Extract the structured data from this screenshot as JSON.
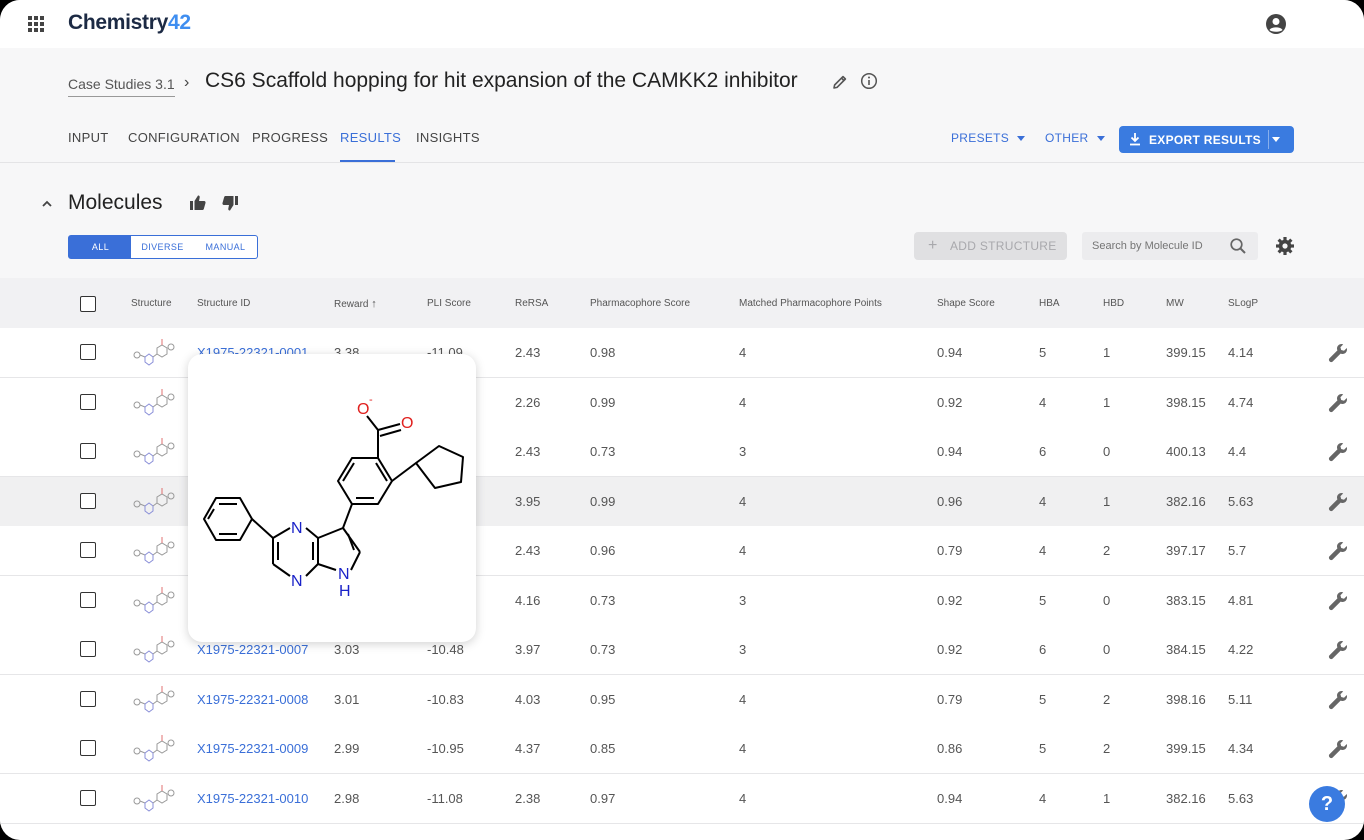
{
  "app": {
    "logo_main": "Chemistry",
    "logo_num": "42"
  },
  "breadcrumb": {
    "parent": "Case Studies 3.1",
    "separator": "›"
  },
  "page_title": "CS6 Scaffold hopping for hit expansion of the CAMKK2 inhibitor",
  "tabs": [
    "INPUT",
    "CONFIGURATION",
    "PROGRESS",
    "RESULTS",
    "INSIGHTS"
  ],
  "active_tab": "RESULTS",
  "header_buttons": {
    "presets": "PRESETS",
    "other": "OTHER",
    "export": "EXPORT RESULTS"
  },
  "section": {
    "title": "Molecules",
    "filters": [
      "ALL",
      "DIVERSE",
      "MANUAL"
    ],
    "active_filter": "ALL",
    "add_structure": "ADD STRUCTURE",
    "search_placeholder": "Search by Molecule ID"
  },
  "table": {
    "columns": [
      "Structure",
      "Structure ID",
      "Reward",
      "PLI Score",
      "ReRSA",
      "Pharmacophore Score",
      "Matched Pharmacophore Points",
      "Shape Score",
      "HBA",
      "HBD",
      "MW",
      "SLogP"
    ],
    "sort_indicator": "↑",
    "rows": [
      {
        "id": "X1975-22321-0001",
        "reward": "3.38",
        "pli": "-11.09",
        "rersa": "2.43",
        "pharm": "0.98",
        "matched": "4",
        "shape": "0.94",
        "hba": "5",
        "hbd": "1",
        "mw": "399.15",
        "slogp": "4.14"
      },
      {
        "id": "",
        "reward": "",
        "pli": "",
        "rersa": "2.26",
        "pharm": "0.99",
        "matched": "4",
        "shape": "0.92",
        "hba": "4",
        "hbd": "1",
        "mw": "398.15",
        "slogp": "4.74"
      },
      {
        "id": "",
        "reward": "",
        "pli": "",
        "rersa": "2.43",
        "pharm": "0.73",
        "matched": "3",
        "shape": "0.94",
        "hba": "6",
        "hbd": "0",
        "mw": "400.13",
        "slogp": "4.4"
      },
      {
        "id": "",
        "reward": "",
        "pli": "",
        "rersa": "3.95",
        "pharm": "0.99",
        "matched": "4",
        "shape": "0.96",
        "hba": "4",
        "hbd": "1",
        "mw": "382.16",
        "slogp": "5.63"
      },
      {
        "id": "",
        "reward": "",
        "pli": "",
        "rersa": "2.43",
        "pharm": "0.96",
        "matched": "4",
        "shape": "0.79",
        "hba": "4",
        "hbd": "2",
        "mw": "397.17",
        "slogp": "5.7"
      },
      {
        "id": "",
        "reward": "",
        "pli": "",
        "rersa": "4.16",
        "pharm": "0.73",
        "matched": "3",
        "shape": "0.92",
        "hba": "5",
        "hbd": "0",
        "mw": "383.15",
        "slogp": "4.81"
      },
      {
        "id": "X1975-22321-0007",
        "reward": "3.03",
        "pli": "-10.48",
        "rersa": "3.97",
        "pharm": "0.73",
        "matched": "3",
        "shape": "0.92",
        "hba": "6",
        "hbd": "0",
        "mw": "384.15",
        "slogp": "4.22"
      },
      {
        "id": "X1975-22321-0008",
        "reward": "3.01",
        "pli": "-10.83",
        "rersa": "4.03",
        "pharm": "0.95",
        "matched": "4",
        "shape": "0.79",
        "hba": "5",
        "hbd": "2",
        "mw": "398.16",
        "slogp": "5.11"
      },
      {
        "id": "X1975-22321-0009",
        "reward": "2.99",
        "pli": "-10.95",
        "rersa": "4.37",
        "pharm": "0.85",
        "matched": "4",
        "shape": "0.86",
        "hba": "5",
        "hbd": "2",
        "mw": "399.15",
        "slogp": "4.34"
      },
      {
        "id": "X1975-22321-0010",
        "reward": "2.98",
        "pli": "-11.08",
        "rersa": "2.38",
        "pharm": "0.97",
        "matched": "4",
        "shape": "0.94",
        "hba": "4",
        "hbd": "1",
        "mw": "382.16",
        "slogp": "5.63"
      }
    ],
    "highlighted_row_index": 3
  },
  "structure_popup": {
    "atom_labels": {
      "o_minus": "O",
      "charge": "-",
      "o": "O",
      "n1": "N",
      "n2": "N",
      "nh": "N",
      "h": "H"
    }
  },
  "help_button": "?",
  "colors": {
    "accent": "#3a6fd8",
    "export_bg": "#3a7be0",
    "oxygen": "#e0201e",
    "nitrogen": "#1a22c8"
  },
  "icons": [
    "apps-grid-icon",
    "user-account-icon",
    "edit-pencil-icon",
    "info-icon",
    "collapse-chevron-icon",
    "thumb-up-icon",
    "thumb-down-icon",
    "search-icon",
    "gear-icon",
    "download-icon",
    "wrench-icon"
  ]
}
